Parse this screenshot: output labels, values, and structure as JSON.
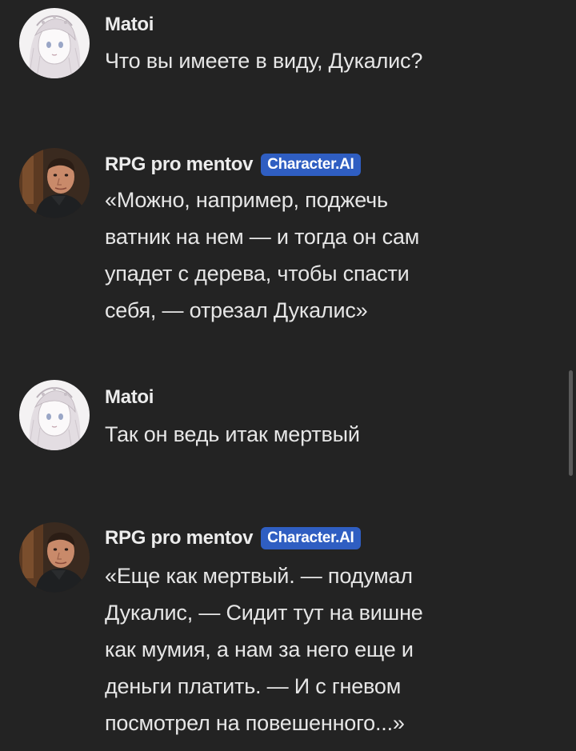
{
  "messages": [
    {
      "author": "Matoi",
      "avatar_icon": "anime-girl-avatar-icon",
      "badge": null,
      "lines": [
        "Что вы имеете в виду, Дукалис?"
      ]
    },
    {
      "author": "RPG pro mentov",
      "avatar_icon": "man-photo-avatar-icon",
      "badge": "Character.AI",
      "lines": [
        "«Можно, например, поджечь",
        "ватник на нем — и тогда он сам",
        "упадет с дерева, чтобы спасти",
        "себя, — отрезал Дукалис»"
      ]
    },
    {
      "author": "Matoi",
      "avatar_icon": "anime-girl-avatar-icon",
      "badge": null,
      "lines": [
        "Так он ведь итак мертвый"
      ]
    },
    {
      "author": "RPG pro mentov",
      "avatar_icon": "man-photo-avatar-icon",
      "badge": "Character.AI",
      "lines": [
        "«Еще как мертвый. — подумал",
        "Дукалис, — Сидит тут на вишне",
        "как мумия, а нам за него еще и",
        "деньги платить. — И с гневом",
        "посмотрел на повешенного...»"
      ]
    }
  ],
  "colors": {
    "background": "#232323",
    "badge": "#2f5ec2",
    "text": "#e6e6e6"
  }
}
